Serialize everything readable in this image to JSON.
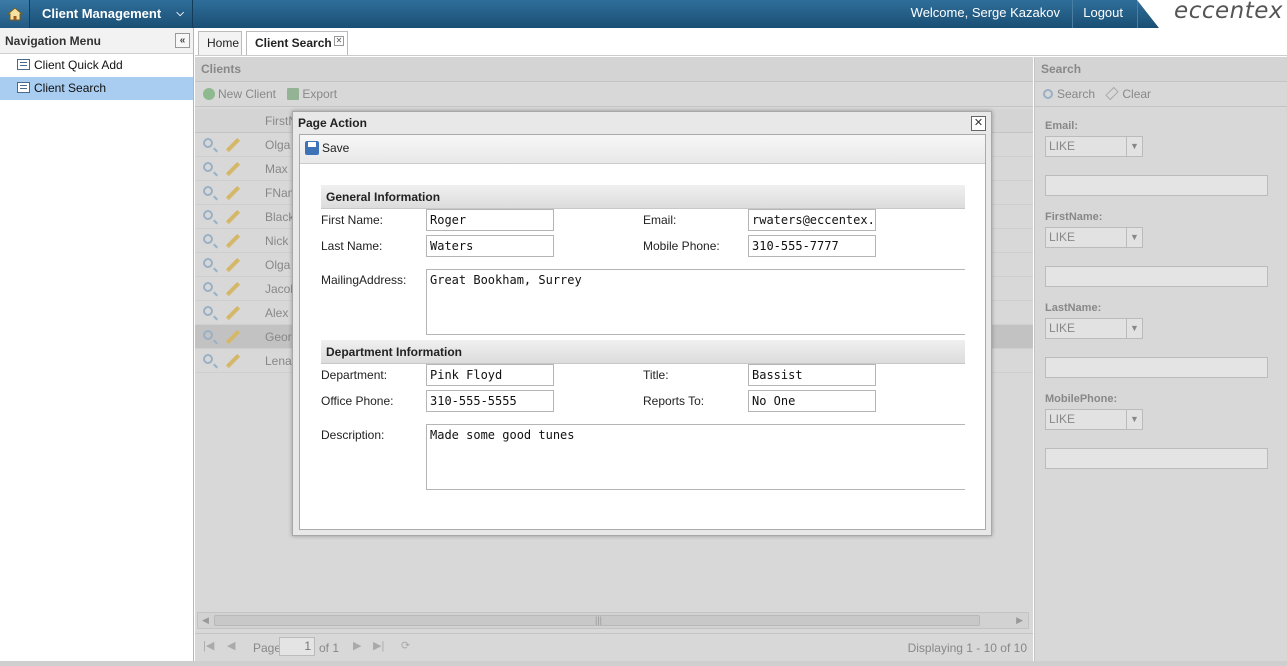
{
  "header": {
    "app_menu_label": "Client Management",
    "welcome_text": "Welcome, Serge Kazakov",
    "logout_label": "Logout",
    "logo_text": "eccentex"
  },
  "nav": {
    "title": "Navigation Menu",
    "items": [
      {
        "label": "Client Quick Add",
        "active": false
      },
      {
        "label": "Client Search",
        "active": true
      }
    ]
  },
  "tabs": [
    {
      "label": "Home"
    },
    {
      "label": "Client Search"
    }
  ],
  "clients": {
    "title": "Clients",
    "toolbar": {
      "new_client": "New Client",
      "export": "Export"
    },
    "column_first": "FirstN",
    "rows": [
      "Olga",
      "Max",
      "FNam",
      "Black",
      "Nick",
      "Olga",
      "Jacob",
      "Alex",
      "Georg",
      "Lena"
    ],
    "pager": {
      "page_label": "Page",
      "page_value": "1",
      "of_label": "of 1",
      "display": "Displaying 1 - 10 of 10"
    }
  },
  "search_panel": {
    "title": "Search",
    "search_label": "Search",
    "clear_label": "Clear",
    "fields": [
      {
        "label": "Email:",
        "operator": "LIKE"
      },
      {
        "label": "FirstName:",
        "operator": "LIKE"
      },
      {
        "label": "LastName:",
        "operator": "LIKE"
      },
      {
        "label": "MobilePhone:",
        "operator": "LIKE"
      }
    ]
  },
  "modal": {
    "title": "Page Action",
    "save_label": "Save",
    "general": {
      "title": "General Information",
      "first_name_label": "First Name:",
      "first_name": "Roger",
      "last_name_label": "Last Name:",
      "last_name": "Waters",
      "email_label": "Email:",
      "email": "rwaters@eccentex.co",
      "mobile_label": "Mobile Phone:",
      "mobile": "310-555-7777",
      "address_label": "MailingAddress:",
      "address": "Great Bookham, Surrey"
    },
    "department": {
      "title": "Department Information",
      "department_label": "Department:",
      "department": "Pink Floyd",
      "office_phone_label": "Office Phone:",
      "office_phone": "310-555-5555",
      "title_label": "Title:",
      "title_value": "Bassist",
      "reports_to_label": "Reports To:",
      "reports_to": "No One",
      "description_label": "Description:",
      "description": "Made some good tunes"
    }
  }
}
